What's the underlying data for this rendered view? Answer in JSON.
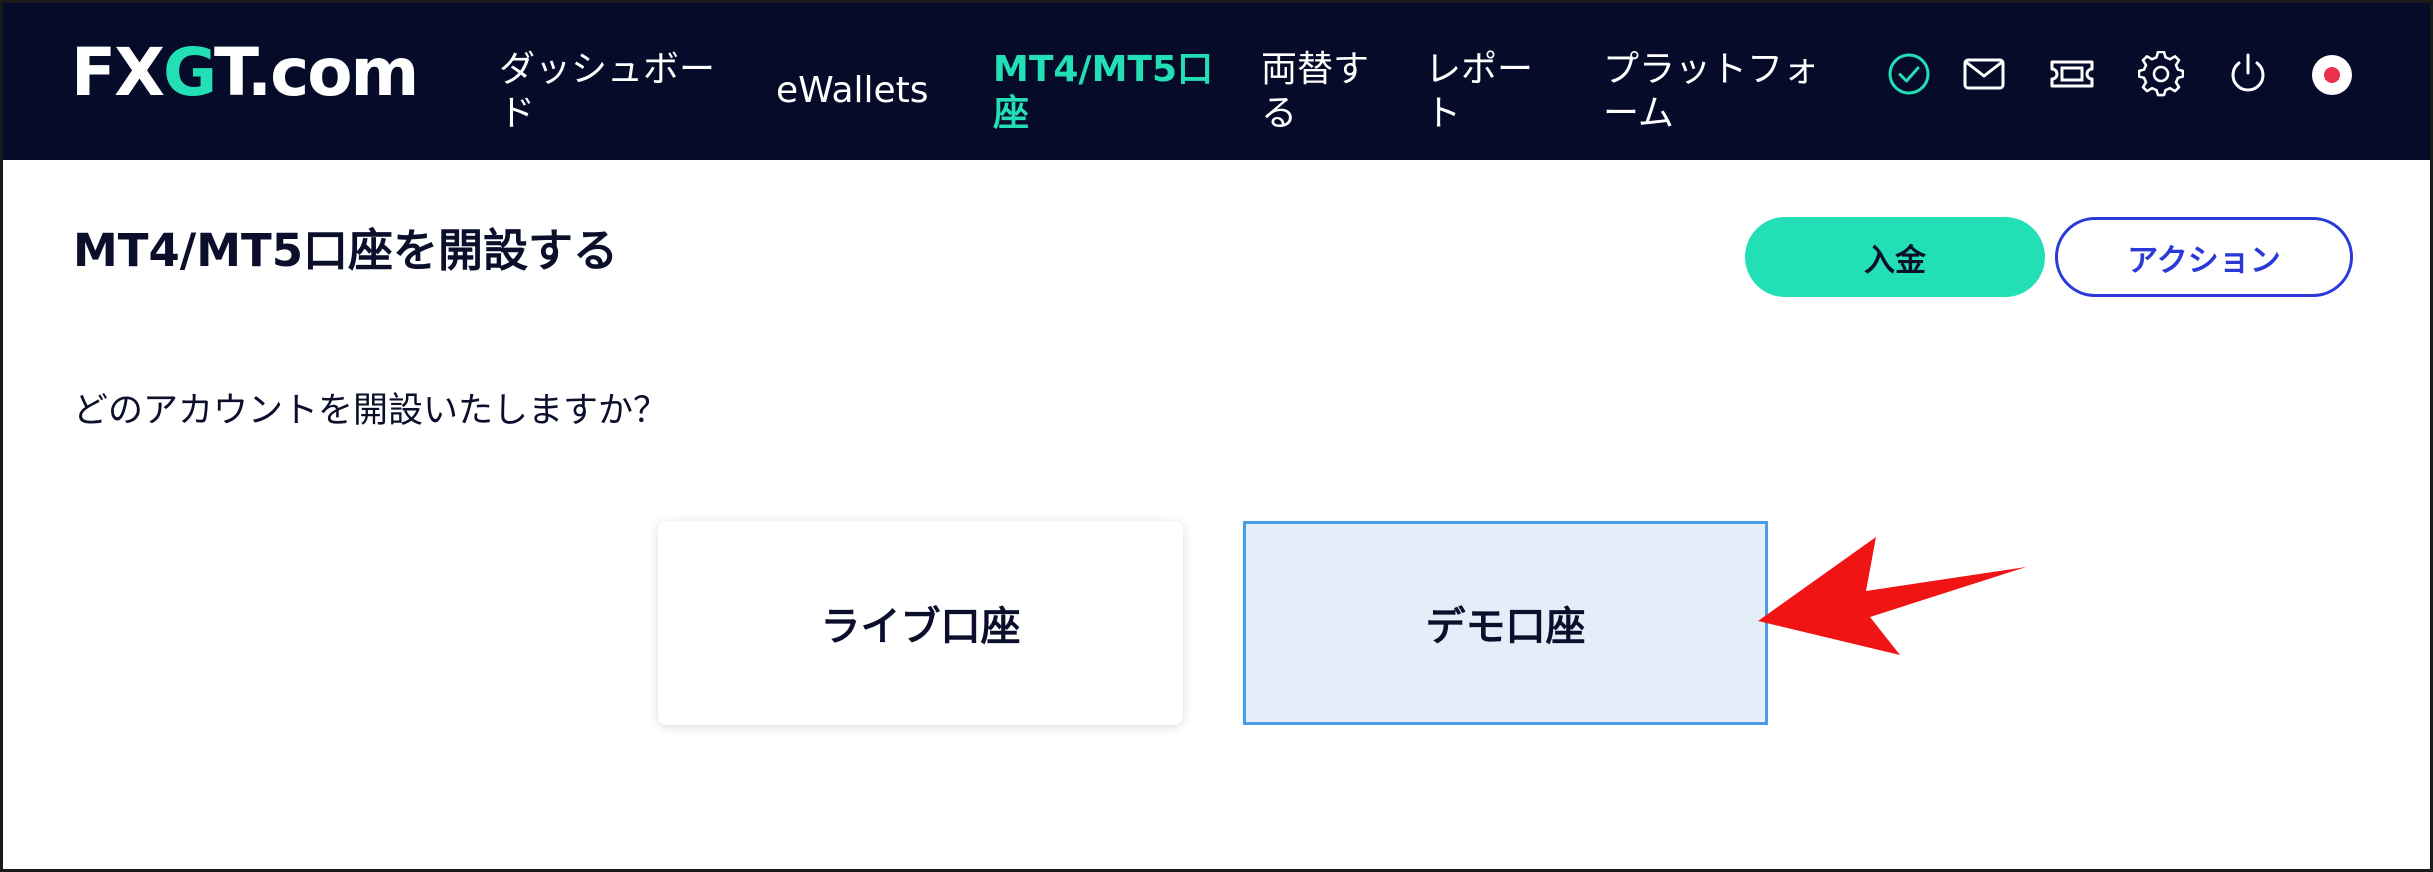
{
  "header": {
    "logo": {
      "part1": "FX",
      "part2": "G",
      "part3": "T",
      "part4": ".com"
    },
    "nav": [
      {
        "label": "ダッシュボード",
        "active": false
      },
      {
        "label": "eWallets",
        "active": false
      },
      {
        "label": "MT4/MT5口座",
        "active": true
      },
      {
        "label": "両替する",
        "active": false
      },
      {
        "label": "レポート",
        "active": false
      },
      {
        "label": "プラットフォーム",
        "active": false
      }
    ],
    "icons": [
      "verified-check-icon",
      "mail-icon",
      "ticket-icon",
      "gear-icon",
      "power-icon",
      "japan-flag-icon"
    ]
  },
  "page": {
    "title": "MT4/MT5口座を開設する",
    "deposit_label": "入金",
    "action_label": "アクション",
    "question": "どのアカウントを開設いたしますか？",
    "options": [
      {
        "label": "ライブ口座",
        "selected": false
      },
      {
        "label": "デモ口座",
        "selected": true
      }
    ]
  },
  "colors": {
    "header_bg": "#050b28",
    "accent": "#22dfb5",
    "action_blue": "#2a3ad8",
    "selected_card_bg": "#e3eef8",
    "selected_card_border": "#4a9be8",
    "annotation_arrow": "#f01414"
  }
}
